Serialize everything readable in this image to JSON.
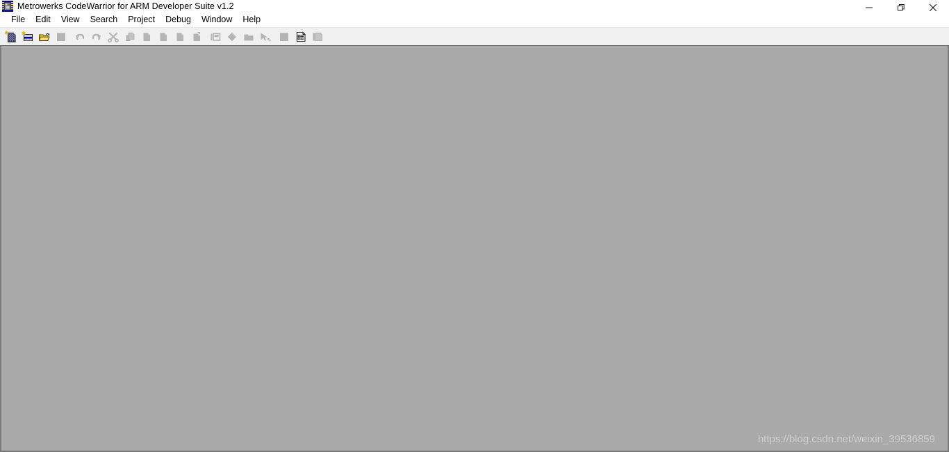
{
  "window": {
    "title": "Metrowerks CodeWarrior for ARM Developer Suite v1.2",
    "app_icon": "cpu-chip-icon",
    "colors": {
      "titlebar_bg": "#ffffff",
      "menubar_bg": "#ffffff",
      "toolbar_bg": "#f0f0f0",
      "client_bg": "#a9a9a9",
      "client_border": "#7a7a7a",
      "text": "#000000",
      "icon_disabled": "#b4b4b4",
      "watermark": "#cfcfcf"
    },
    "controls": [
      {
        "name": "minimize-button",
        "glyph": "minimize-icon",
        "label": "Minimize"
      },
      {
        "name": "maximize-button",
        "glyph": "restore-icon",
        "label": "Restore"
      },
      {
        "name": "close-button",
        "glyph": "close-icon",
        "label": "Close"
      }
    ]
  },
  "menubar": {
    "items": [
      {
        "label": "File"
      },
      {
        "label": "Edit"
      },
      {
        "label": "View"
      },
      {
        "label": "Search"
      },
      {
        "label": "Project"
      },
      {
        "label": "Debug"
      },
      {
        "label": "Window"
      },
      {
        "label": "Help"
      }
    ]
  },
  "toolbar": {
    "buttons": [
      {
        "name": "new-text-file-button",
        "icon": "new-text-file-icon",
        "enabled": true,
        "tooltip": "New Text File"
      },
      {
        "name": "new-project-button",
        "icon": "new-project-icon",
        "enabled": true,
        "tooltip": "New Project"
      },
      {
        "name": "open-file-button",
        "icon": "open-folder-icon",
        "enabled": true,
        "tooltip": "Open"
      },
      {
        "name": "save-button",
        "icon": "save-icon",
        "enabled": false,
        "tooltip": "Save"
      },
      {
        "name": "undo-button",
        "icon": "undo-arrow-icon",
        "enabled": false,
        "tooltip": "Undo"
      },
      {
        "name": "redo-button",
        "icon": "redo-arrow-icon",
        "enabled": false,
        "tooltip": "Redo"
      },
      {
        "name": "cut-button",
        "icon": "scissors-icon",
        "enabled": false,
        "tooltip": "Cut"
      },
      {
        "name": "copy-button",
        "icon": "copy-icon",
        "enabled": false,
        "tooltip": "Copy"
      },
      {
        "name": "paste-button",
        "icon": "paste-icon",
        "enabled": false,
        "tooltip": "Paste"
      },
      {
        "name": "find-button",
        "icon": "find-page-icon",
        "enabled": false,
        "tooltip": "Find"
      },
      {
        "name": "find-next-button",
        "icon": "find-next-page-icon",
        "enabled": false,
        "tooltip": "Find Next"
      },
      {
        "name": "find-in-files-button",
        "icon": "find-in-files-icon",
        "enabled": false,
        "tooltip": "Find in Files"
      },
      {
        "name": "toggle-panel-button",
        "icon": "panel-layout-icon",
        "enabled": false,
        "tooltip": "Toggle Panel"
      },
      {
        "name": "bookmark-button",
        "icon": "marker-icon",
        "enabled": false,
        "tooltip": "Marker"
      },
      {
        "name": "folder-view-button",
        "icon": "folder-icon",
        "enabled": false,
        "tooltip": "Folder"
      },
      {
        "name": "run-debug-button",
        "icon": "debug-bug-icon",
        "enabled": false,
        "tooltip": "Debug"
      },
      {
        "name": "stop-button",
        "icon": "stop-square-icon",
        "enabled": false,
        "tooltip": "Stop"
      },
      {
        "name": "project-settings-button",
        "icon": "settings-doc-icon",
        "enabled": true,
        "tooltip": "Project Settings"
      },
      {
        "name": "tile-windows-button",
        "icon": "tile-windows-icon",
        "enabled": false,
        "tooltip": "Tile Windows"
      }
    ]
  },
  "client": {
    "watermark": "https://blog.csdn.net/weixin_39536859"
  }
}
